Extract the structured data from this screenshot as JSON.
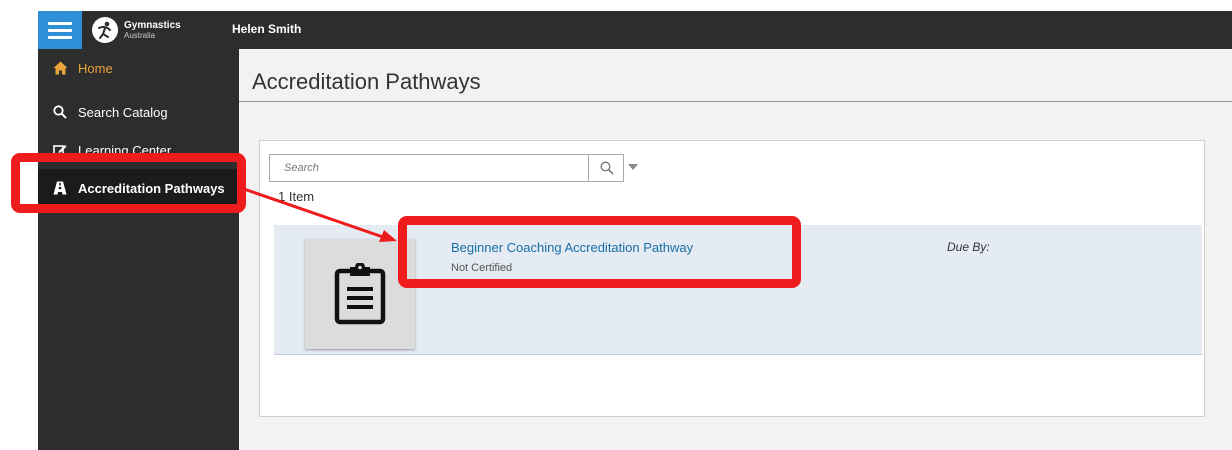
{
  "topbar": {
    "logo_title": "Gymnastics",
    "logo_subtitle": "Australia",
    "user_name": "Helen Smith"
  },
  "sidebar": {
    "items": [
      {
        "label": "Home",
        "icon": "home-icon",
        "color": "#e8a33b"
      },
      {
        "label": "Search Catalog",
        "icon": "search-icon"
      },
      {
        "label": "Learning Center",
        "icon": "edit-icon"
      },
      {
        "label": "Accreditation Pathways",
        "icon": "pathway-icon",
        "selected": true
      }
    ]
  },
  "main": {
    "title": "Accreditation Pathways",
    "search": {
      "placeholder": "Search"
    },
    "item_count": "1 Item",
    "items": [
      {
        "title": "Beginner Coaching Accreditation Pathway",
        "status": "Not Certified",
        "due_label": "Due By:",
        "thumbnail_icon": "clipboard-icon"
      }
    ]
  },
  "colors": {
    "topbar": "#2d2d2d",
    "menu_button": "#2e8fd6",
    "home_accent": "#e8a33b",
    "link": "#1a6ea8",
    "row_highlight": "#e4ebf2",
    "annotation": "#ee1c1c"
  }
}
